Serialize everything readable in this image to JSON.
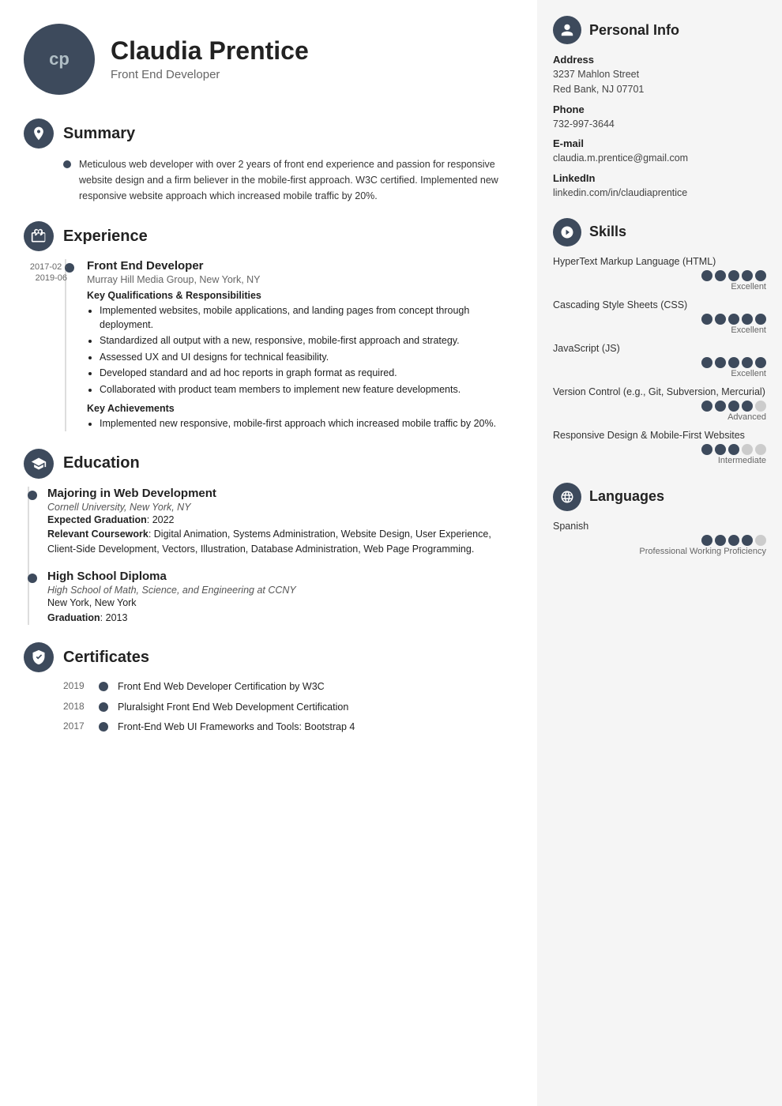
{
  "header": {
    "initials": "cp",
    "name": "Claudia Prentice",
    "subtitle": "Front End Developer"
  },
  "summary": {
    "title": "Summary",
    "text": "Meticulous web developer with over 2 years of front end experience and passion for responsive website design and a firm believer in the mobile-first approach. W3C certified. Implemented new responsive website approach which increased mobile traffic by 20%."
  },
  "experience": {
    "title": "Experience",
    "items": [
      {
        "title": "Front End Developer",
        "company": "Murray Hill Media Group, New York, NY",
        "date_start": "2017-02 -",
        "date_end": "2019-06",
        "key_qualifications_label": "Key Qualifications & Responsibilities",
        "responsibilities": [
          "Implemented websites, mobile applications, and landing pages from concept through deployment.",
          "Standardized all output with a new, responsive, mobile-first approach and strategy.",
          "Assessed UX and UI designs for technical feasibility.",
          "Developed standard and ad hoc reports in graph format as required.",
          "Collaborated with product team members to implement new feature developments."
        ],
        "key_achievements_label": "Key Achievements",
        "achievements": [
          "Implemented new responsive, mobile-first approach which increased mobile traffic by 20%."
        ]
      }
    ]
  },
  "education": {
    "title": "Education",
    "items": [
      {
        "degree": "Majoring in Web Development",
        "school": "Cornell University, New York, NY",
        "graduation_label": "Expected Graduation",
        "graduation": "2022",
        "coursework_label": "Relevant Coursework",
        "coursework": "Digital Animation, Systems Administration, Website Design, User Experience, Client-Side Development, Vectors, Illustration, Database Administration, Web Page Programming."
      },
      {
        "degree": "High School Diploma",
        "school": "High School of Math, Science, and Engineering at CCNY",
        "location": "New York, New York",
        "graduation_label": "Graduation",
        "graduation": "2013"
      }
    ]
  },
  "certificates": {
    "title": "Certificates",
    "items": [
      {
        "year": "2019",
        "text": "Front End Web Developer Certification by W3C"
      },
      {
        "year": "2018",
        "text": "Pluralsight Front End Web Development Certification"
      },
      {
        "year": "2017",
        "text": "Front-End Web UI Frameworks and Tools: Bootstrap 4"
      }
    ]
  },
  "personal_info": {
    "title": "Personal Info",
    "address_label": "Address",
    "address_line1": "3237 Mahlon Street",
    "address_line2": "Red Bank, NJ 07701",
    "phone_label": "Phone",
    "phone": "732-997-3644",
    "email_label": "E-mail",
    "email": "claudia.m.prentice@gmail.com",
    "linkedin_label": "LinkedIn",
    "linkedin": "linkedin.com/in/claudiaprentice"
  },
  "skills": {
    "title": "Skills",
    "items": [
      {
        "name": "HyperText Markup Language (HTML)",
        "filled": 5,
        "total": 5,
        "level": "Excellent"
      },
      {
        "name": "Cascading Style Sheets (CSS)",
        "filled": 5,
        "total": 5,
        "level": "Excellent"
      },
      {
        "name": "JavaScript (JS)",
        "filled": 5,
        "total": 5,
        "level": "Excellent"
      },
      {
        "name": "Version Control (e.g., Git, Subversion, Mercurial)",
        "filled": 4,
        "total": 5,
        "level": "Advanced"
      },
      {
        "name": "Responsive Design & Mobile-First Websites",
        "filled": 3,
        "total": 5,
        "level": "Intermediate"
      }
    ]
  },
  "languages": {
    "title": "Languages",
    "items": [
      {
        "name": "Spanish",
        "filled": 4,
        "total": 5,
        "level": "Professional Working Proficiency"
      }
    ]
  }
}
